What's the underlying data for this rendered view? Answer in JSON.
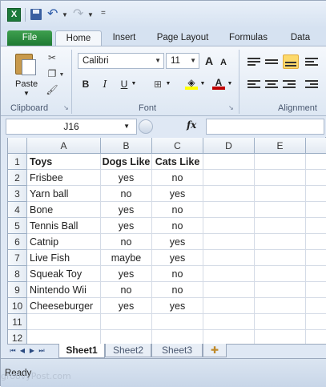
{
  "qat": {
    "app_icon": "X",
    "icons": [
      "excel-icon",
      "save-icon",
      "undo-icon",
      "redo-icon"
    ],
    "customize": "="
  },
  "tabs": [
    {
      "label": "File"
    },
    {
      "label": "Home"
    },
    {
      "label": "Insert"
    },
    {
      "label": "Page Layout"
    },
    {
      "label": "Formulas"
    },
    {
      "label": "Data"
    }
  ],
  "ribbon": {
    "clipboard": {
      "paste_label": "Paste",
      "group_label": "Clipboard"
    },
    "font": {
      "name": "Calibri",
      "size": "11",
      "grow": "A",
      "shrink": "A",
      "bold": "B",
      "italic": "I",
      "underline": "U",
      "group_label": "Font"
    },
    "alignment": {
      "group_label": "Alignment"
    }
  },
  "formula_bar": {
    "name_box": "J16",
    "fx": "fx",
    "content": ""
  },
  "grid": {
    "columns": [
      "A",
      "B",
      "C",
      "D",
      "E"
    ],
    "rows": [
      {
        "n": "1",
        "a": "Toys",
        "b": "Dogs Like",
        "c": "Cats Like",
        "bold": true
      },
      {
        "n": "2",
        "a": "Frisbee",
        "b": "yes",
        "c": "no"
      },
      {
        "n": "3",
        "a": "Yarn ball",
        "b": "no",
        "c": "yes"
      },
      {
        "n": "4",
        "a": "Bone",
        "b": "yes",
        "c": "no"
      },
      {
        "n": "5",
        "a": "Tennis Ball",
        "b": "yes",
        "c": "no"
      },
      {
        "n": "6",
        "a": "Catnip",
        "b": "no",
        "c": "yes"
      },
      {
        "n": "7",
        "a": "Live Fish",
        "b": "maybe",
        "c": "yes"
      },
      {
        "n": "8",
        "a": "Squeak Toy",
        "b": "yes",
        "c": "no"
      },
      {
        "n": "9",
        "a": "Nintendo Wii",
        "b": "no",
        "c": "no"
      },
      {
        "n": "10",
        "a": "Cheeseburger",
        "b": "yes",
        "c": "yes"
      },
      {
        "n": "11",
        "a": "",
        "b": "",
        "c": ""
      },
      {
        "n": "12",
        "a": "",
        "b": "",
        "c": ""
      }
    ]
  },
  "sheets": [
    {
      "label": "Sheet1"
    },
    {
      "label": "Sheet2"
    },
    {
      "label": "Sheet3"
    }
  ],
  "status": {
    "ready": "Ready"
  },
  "watermark": "groovyPost.com",
  "colors": {
    "file_tab": "#1f7a33",
    "accent_highlight": "#fcd96b",
    "font_color": "#c00000",
    "fill_color": "#ffff00"
  }
}
